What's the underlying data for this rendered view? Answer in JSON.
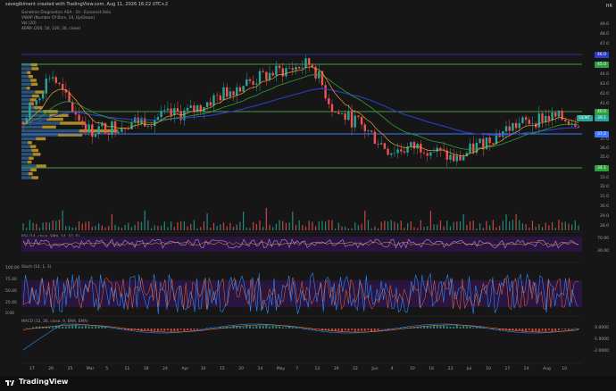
{
  "credit": "savegibiment created with TradingView.com, Aug 11, 2026 16:22 UTC+2",
  "legend": {
    "main": "Genetron Diagnostics ASA · 1h · Euronext Oslo",
    "vwap": "VWAP (Number Of Bars, 24, Up/Down)",
    "vol": "Vol (20)",
    "ema": "4EMA (200, 50, 100, 20, close)",
    "rsi": "RSI (14, close, SMA, 14, 10, 0)",
    "stoch": "Stoch (14, 1, 3)",
    "macd": "MACD (12, 26, close, 9, EMA, EMA)"
  },
  "price_axis": {
    "labels": [
      "49.0",
      "48.0",
      "47.0",
      "46.0",
      "45.0",
      "44.0",
      "43.0",
      "42.0",
      "41.0",
      "40.0",
      "39.0",
      "38.0",
      "37.0",
      "36.0",
      "35.0",
      "34.0",
      "33.0",
      "32.0",
      "31.0",
      "30.0",
      "29.0",
      "28.0"
    ],
    "marker_46": "46.0",
    "marker_45": "45.0",
    "marker_40": "40.0",
    "marker_39": "39.1",
    "marker_37": "37.2",
    "marker_34": "34.1",
    "ticker": "GENT"
  },
  "rsi_axis": [
    "70.00",
    "30.00"
  ],
  "stoch_axis": [
    "100.00",
    "75.00",
    "50.00",
    "25.00",
    "0.00"
  ],
  "macd_axis": [
    "0.0000",
    "-1.0000",
    "-2.0000"
  ],
  "date_axis": [
    "17",
    "20",
    "25",
    "Mar",
    "5",
    "11",
    "18",
    "24",
    "Apr",
    "10",
    "15",
    "20",
    "24",
    "May",
    "7",
    "13",
    "19",
    "22",
    "Jun",
    "4",
    "10",
    "16",
    "23",
    "Jul",
    "10",
    "17",
    "24",
    "Aug",
    "10"
  ],
  "colors": {
    "candle_up": "#26a69a",
    "candle_down": "#ef5350",
    "ema_blue": "#2b3ec8",
    "ema_green": "#2f9e3c",
    "ema_orange": "#f0a030",
    "level_line": "#5bbf5b",
    "blue_level": "#3a7bff",
    "rsi_bg": "#2a1540",
    "stoch_bg": "#2a1540"
  },
  "footer": {
    "brand": "TradingView",
    "hr": "HR"
  }
}
